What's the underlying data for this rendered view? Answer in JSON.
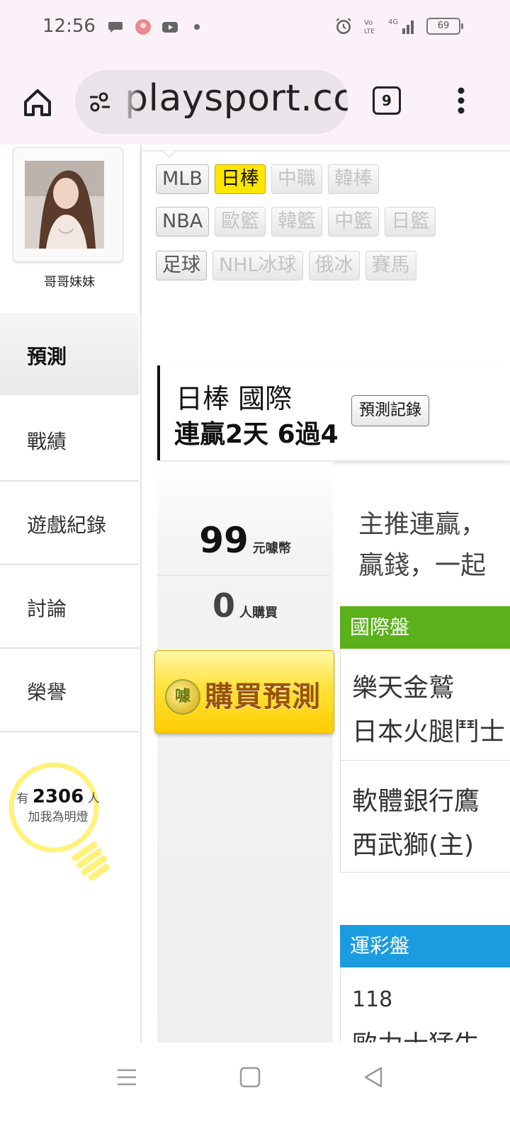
{
  "status_bar": {
    "time": "12:56",
    "battery": "69",
    "icons_left": [
      "chat-bubble-icon",
      "app-avatar-icon",
      "youtube-icon",
      "dot-icon"
    ],
    "icons_right": [
      "alarm-icon",
      "volte-icon",
      "signal-4g-icon",
      "battery-icon"
    ]
  },
  "browser": {
    "url": "playsport.cc",
    "tab_count": "9"
  },
  "profile": {
    "name": "哥哥妹妹"
  },
  "sidebar": {
    "items": [
      {
        "label": "預測",
        "active": true
      },
      {
        "label": "戰績",
        "active": false
      },
      {
        "label": "遊戲紀錄",
        "active": false
      },
      {
        "label": "討論",
        "active": false
      },
      {
        "label": "榮譽",
        "active": false
      }
    ],
    "fans": {
      "prefix": "有",
      "count": "2306",
      "suffix": "人",
      "line2": "加我為明燈"
    }
  },
  "leagues": {
    "row1": [
      {
        "label": "MLB",
        "state": "enabled"
      },
      {
        "label": "日棒",
        "state": "selected"
      },
      {
        "label": "中職",
        "state": "disabled"
      },
      {
        "label": "韓棒",
        "state": "disabled"
      }
    ],
    "row2": [
      {
        "label": "NBA",
        "state": "enabled"
      },
      {
        "label": "歐籃",
        "state": "disabled"
      },
      {
        "label": "韓籃",
        "state": "disabled"
      },
      {
        "label": "中籃",
        "state": "disabled"
      },
      {
        "label": "日籃",
        "state": "disabled"
      }
    ],
    "row3": [
      {
        "label": "足球",
        "state": "enabled"
      },
      {
        "label": "NHL冰球",
        "state": "disabled"
      },
      {
        "label": "俄冰",
        "state": "disabled"
      },
      {
        "label": "賽馬",
        "state": "disabled"
      }
    ]
  },
  "prediction": {
    "title": "日棒 國際",
    "subtitle": "連贏2天 6過4",
    "record_button": "預測記錄",
    "price": "99",
    "price_unit": "元噱幣",
    "buyers": "0",
    "buyers_unit": "人購買",
    "buy_button": "購買預測",
    "buy_coin": "噱",
    "promo_line1": "主推連贏，",
    "promo_line2": "贏錢，一起"
  },
  "intl_section": {
    "header": "國際盤",
    "matches": [
      {
        "team1": "樂天金鷲",
        "team2": "日本火腿鬥士"
      },
      {
        "team1": "軟體銀行鷹",
        "team2": "西武獅(主)"
      }
    ]
  },
  "lottery_section": {
    "header": "運彩盤",
    "code": "118",
    "team": "歐力士猛牛"
  },
  "colors": {
    "selected_league": "#ffe600",
    "intl_header": "#5cb01b",
    "lottery_header": "#1b9ce0",
    "browser_bg": "#fbf2f9"
  }
}
